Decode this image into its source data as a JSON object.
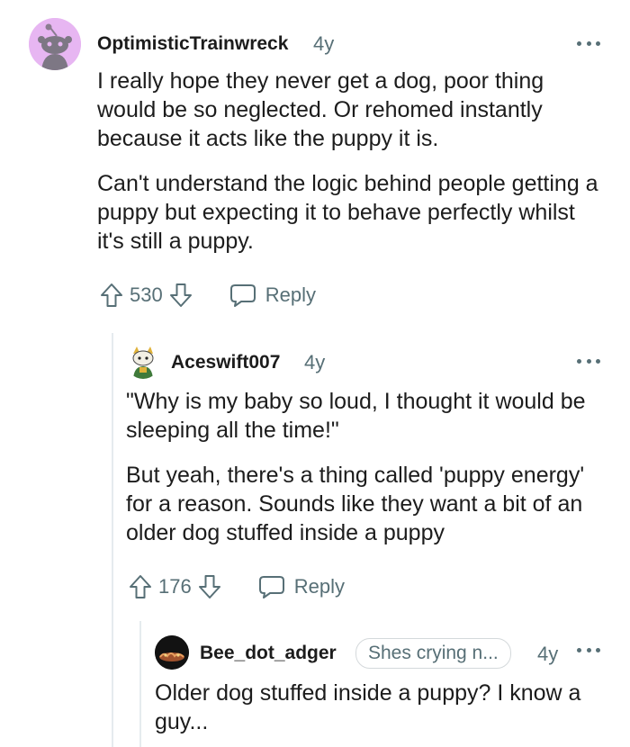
{
  "comments": [
    {
      "username": "OptimisticTrainwreck",
      "age": "4y",
      "paragraphs": [
        "I really hope they never get a dog, poor thing would be so neglected. Or rehomed instantly because it acts like the puppy it is.",
        "Can't understand the logic behind people getting a puppy but expecting it to behave perfectly whilst it's still a puppy."
      ],
      "score": "530",
      "reply_label": "Reply"
    },
    {
      "username": "Aceswift007",
      "age": "4y",
      "paragraphs": [
        "\"Why is my baby so loud, I thought it would be sleeping all the time!\"",
        "But yeah, there's a thing called 'puppy energy' for a reason. Sounds like they want a bit of an older dog stuffed inside a puppy"
      ],
      "score": "176",
      "reply_label": "Reply"
    },
    {
      "username": "Bee_dot_adger",
      "flair": "Shes crying n...",
      "age": "4y",
      "paragraphs": [
        "Older dog stuffed inside a puppy? I know a guy..."
      ]
    }
  ],
  "colors": {
    "text": "#1c1c1c",
    "meta": "#576f76",
    "thread_line": "#e5ebee",
    "avatar_bg_1": "#e7b6f2"
  }
}
